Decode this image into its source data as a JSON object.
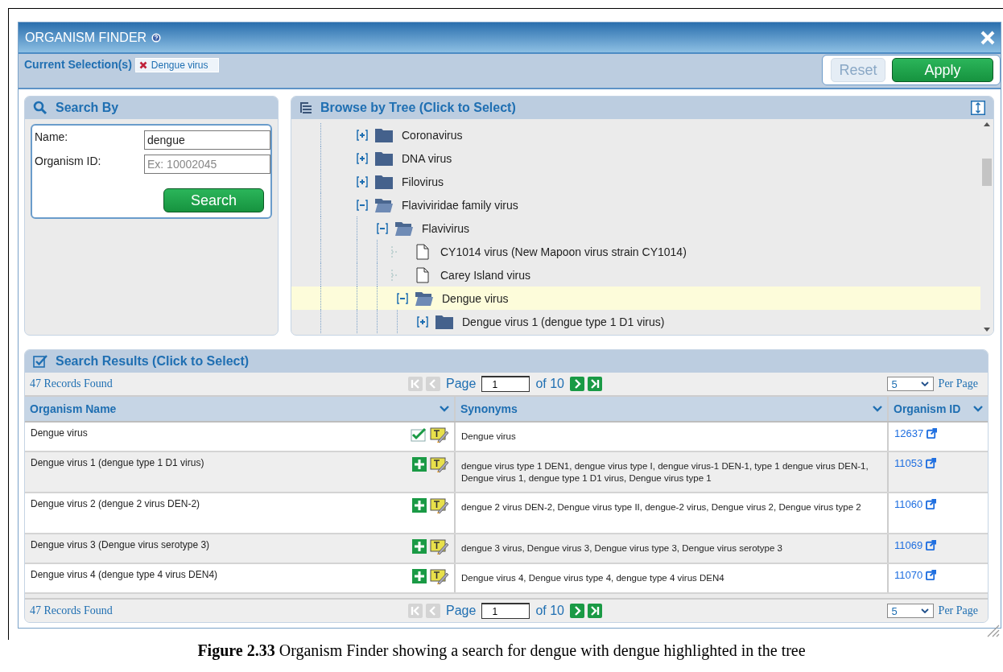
{
  "dialog": {
    "title": "ORGANISM FINDER",
    "current_selection": {
      "label": "Current Selection(s)",
      "chips": [
        {
          "label": "Dengue virus"
        }
      ]
    },
    "buttons": [
      {
        "label": "Reset",
        "kind": "secondary",
        "disabled": true
      },
      {
        "label": "Apply",
        "kind": "primary",
        "disabled": false
      }
    ]
  },
  "search_by": {
    "title": "Search By",
    "fields": [
      {
        "label": "Name:",
        "value": "dengue"
      },
      {
        "label": "Organism ID:",
        "placeholder": "Ex: 10002045"
      }
    ],
    "button": "Search"
  },
  "tree": {
    "title": "Browse by Tree (Click to Select)",
    "items": [
      {
        "label": "Coronavirus",
        "kind": "folder",
        "expanded": false,
        "highlighted": false
      },
      {
        "label": "DNA virus",
        "kind": "folder",
        "expanded": false,
        "highlighted": false
      },
      {
        "label": "Filovirus",
        "kind": "folder",
        "expanded": false,
        "highlighted": false
      },
      {
        "label": "Flaviviridae family virus",
        "kind": "folder",
        "expanded": true,
        "highlighted": false,
        "children": [
          {
            "label": "Flavivirus",
            "kind": "folder",
            "expanded": true,
            "highlighted": false,
            "children": [
              {
                "label": "CY1014 virus (New Mapoon virus strain CY1014)",
                "kind": "leaf",
                "highlighted": false
              },
              {
                "label": "Carey Island virus",
                "kind": "leaf",
                "highlighted": false
              },
              {
                "label": "Dengue virus",
                "kind": "folder",
                "expanded": true,
                "highlighted": true,
                "children": [
                  {
                    "label": "Dengue virus 1 (dengue type 1 D1 virus)",
                    "kind": "folder",
                    "expanded": false,
                    "highlighted": false
                  }
                ]
              }
            ]
          }
        ]
      }
    ]
  },
  "results": {
    "title": "Search Results (Click to Select)",
    "pagers": [
      {
        "records": "47 Records Found",
        "page_label": "Page",
        "page": "1",
        "of": "of 10",
        "per_page": "5",
        "per_page_label": "Per Page"
      },
      {
        "records": "47 Records Found",
        "page_label": "Page",
        "page": "1",
        "of": "of 10",
        "per_page": "5",
        "per_page_label": "Per Page"
      }
    ],
    "columns": [
      "Organism Name",
      "Synonyms",
      "Organism ID"
    ],
    "rows": [
      {
        "name": "Dengue virus",
        "selected": true,
        "synonyms": "Dengue virus",
        "id": "12637"
      },
      {
        "name": "Dengue virus 1 (dengue type 1 D1 virus)",
        "selected": false,
        "synonyms": "dengue virus type 1 DEN1, dengue virus type I, dengue virus-1 DEN-1, type 1 dengue virus DEN-1, Dengue virus 1, dengue type 1 D1 virus, Dengue virus type 1",
        "id": "11053"
      },
      {
        "name": "Dengue virus 2 (dengue 2 virus DEN-2)",
        "selected": false,
        "synonyms": "dengue 2 virus DEN-2, Dengue virus type II, dengue-2 virus, Dengue virus 2, Dengue virus type 2",
        "id": "11060"
      },
      {
        "name": "Dengue virus 3 (Dengue virus serotype 3)",
        "selected": false,
        "synonyms": "dengue 3 virus, Dengue virus 3, Dengue virus type 3, Dengue virus serotype 3",
        "id": "11069"
      },
      {
        "name": "Dengue virus 4 (dengue type 4 virus DEN4)",
        "selected": false,
        "synonyms": "Dengue virus 4, Dengue virus type 4, dengue type 4 virus DEN4",
        "id": "11070"
      }
    ]
  },
  "caption": "**Figure 2.33** Organism Finder showing a search for dengue with dengue highlighted in the tree"
}
